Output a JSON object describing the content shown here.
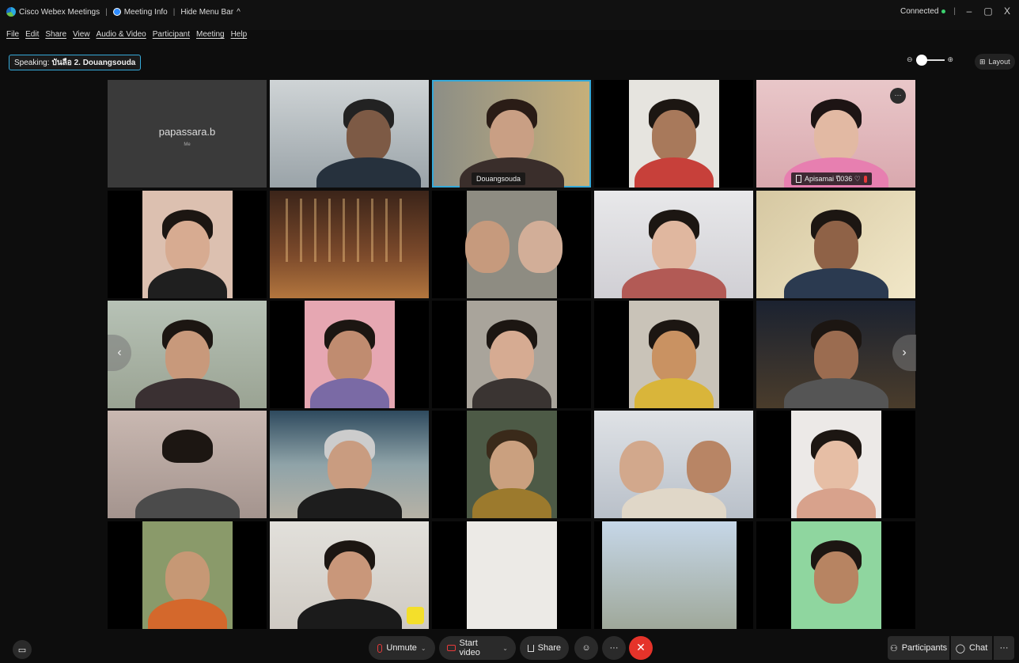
{
  "titlebar": {
    "app_name": "Cisco Webex Meetings",
    "meeting_info": "Meeting Info",
    "hide_menu": "Hide Menu Bar",
    "hide_menu_chevron": "^",
    "status": "Connected"
  },
  "window": {
    "minimize": "–",
    "restore": "▢",
    "close": "X"
  },
  "menu": [
    "File",
    "Edit",
    "Share",
    "View",
    "Audio & Video",
    "Participant",
    "Meeting",
    "Help"
  ],
  "speaking": {
    "label": "Speaking:",
    "name": "บันลือ 2. Douangsouda"
  },
  "zoom": {
    "zoom_out": "⊖",
    "zoom_in": "⊕"
  },
  "layout_label": "Layout",
  "self": {
    "name": "papassara.b",
    "tag": "Me"
  },
  "tiles": [
    {
      "label": "Douangsouda"
    },
    {
      "label": "Apisamai ปี036 ♡"
    }
  ],
  "tile_more": "···",
  "nav": {
    "prev": "‹",
    "next": "›"
  },
  "controls": {
    "unmute": "Unmute",
    "start_video": "Start video",
    "share": "Share",
    "reactions": "☺",
    "more": "···",
    "end": "✕",
    "chevron": "⌄"
  },
  "panels": {
    "participants": "Participants",
    "chat": "Chat",
    "more": "···"
  },
  "captions_icon": "▭",
  "colors": {
    "accent": "#35a9d8",
    "end_red": "#e5332a",
    "connected_green": "#3bd16f"
  }
}
